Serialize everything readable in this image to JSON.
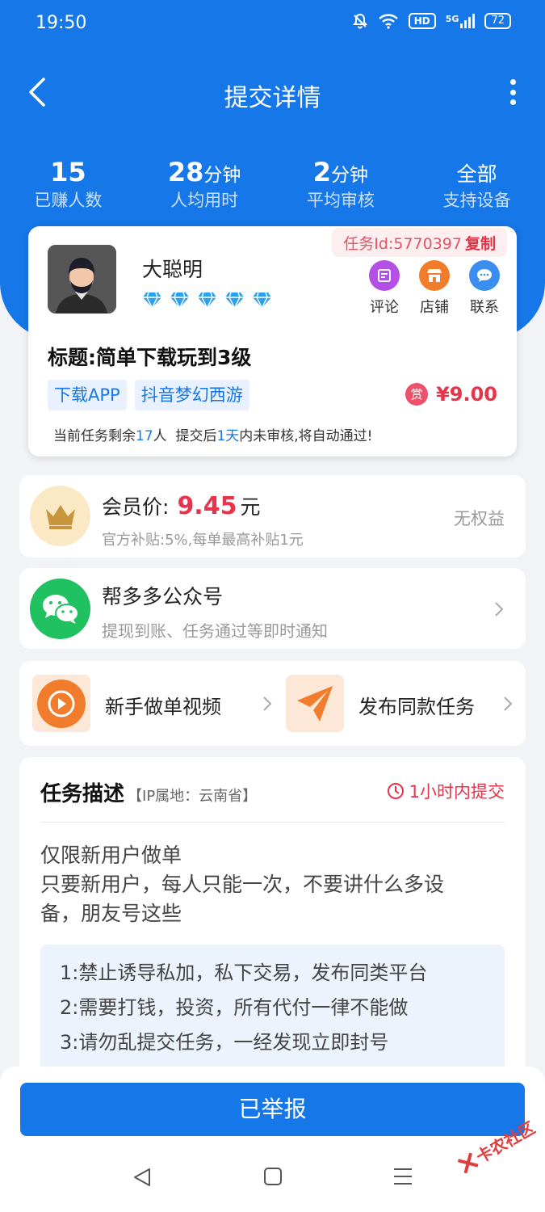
{
  "status_bar": {
    "time": "19:50",
    "hd_label": "HD",
    "net_label": "5G",
    "battery": "72"
  },
  "nav": {
    "title": "提交详情"
  },
  "stats": [
    {
      "value": "15",
      "unit": "",
      "label": "已赚人数"
    },
    {
      "value": "28",
      "unit": "分钟",
      "label": "人均用时"
    },
    {
      "value": "2",
      "unit": "分钟",
      "label": "平均审核"
    },
    {
      "value": "",
      "unit": "全部",
      "label": "支持设备"
    }
  ],
  "task": {
    "username": "大聪明",
    "diamond_count": 5,
    "task_id_label": "任务Id:5770397",
    "copy_label": "复制",
    "actions": [
      {
        "label": "评论",
        "icon": "comment-icon",
        "color": "#b450e6"
      },
      {
        "label": "店铺",
        "icon": "store-icon",
        "color": "#f07c2c"
      },
      {
        "label": "联系",
        "icon": "chat-bubble-icon",
        "color": "#3b8ef0"
      }
    ],
    "title": "标题:简单下载玩到3级",
    "tags": [
      "下载APP",
      "抖音梦幻西游"
    ],
    "reward_badge": "赏",
    "reward_amount": "¥9.00",
    "remain_prefix": "当前任务剩余",
    "remain_count": "17",
    "remain_mid": "人  提交后",
    "remain_days": "1天",
    "remain_suffix": "内未审核,将自动通过!"
  },
  "vip": {
    "label": "会员价:",
    "price": "9.45",
    "unit": "元",
    "subtitle": "官方补贴:5%,每单最高补贴1元",
    "right_text": "无权益"
  },
  "wechat": {
    "title": "帮多多公众号",
    "subtitle": "提现到账、任务通过等即时通知"
  },
  "shortcuts": [
    {
      "label": "新手做单视频",
      "icon": "play-video-icon"
    },
    {
      "label": "发布同款任务",
      "icon": "paper-plane-icon"
    }
  ],
  "description": {
    "title": "任务描述",
    "ip_label": "【IP属地：云南省】",
    "deadline": "1小时内提交",
    "body_lines": [
      "仅限新用户做单",
      "只要新用户，每人只能一次，不要讲什么多设备，朋友号这些"
    ],
    "rules": [
      "1:禁止诱导私加，私下交易，发布同类平台",
      "2:需要打钱，投资，所有代付一律不能做",
      "3:请勿乱提交任务，一经发现立即封号"
    ]
  },
  "bottom": {
    "button_label": "已举报"
  },
  "watermark": {
    "text": "卡农社区"
  },
  "colors": {
    "primary": "#1677e8",
    "reward_red": "#e9334b",
    "wechat_green": "#1fc160"
  }
}
